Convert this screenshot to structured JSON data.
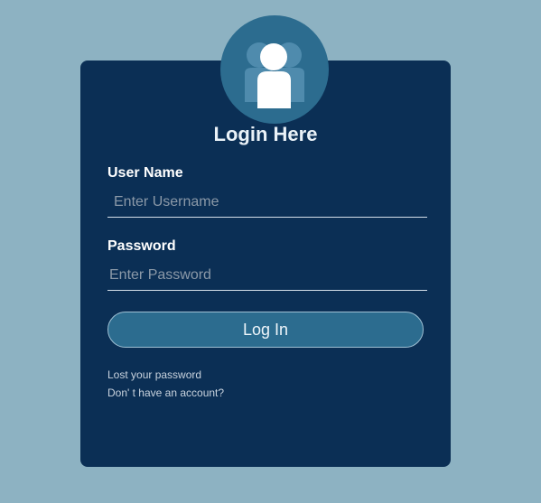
{
  "login_form": {
    "title": "Login Here",
    "username": {
      "label": "User Name",
      "placeholder": "Enter Username",
      "value": ""
    },
    "password": {
      "label": "Password",
      "placeholder": "Enter Password",
      "value": ""
    },
    "submit_label": "Log In",
    "links": {
      "lost_password": "Lost your password",
      "create_account": "Don' t have an account?"
    }
  },
  "avatar": {
    "icon": "users-group-icon"
  },
  "colors": {
    "page_background": "#8db2c2",
    "card_background": "#0b2f55",
    "accent": "#2c6c8f",
    "text": "#ffffff",
    "placeholder": "#8b99a8"
  }
}
